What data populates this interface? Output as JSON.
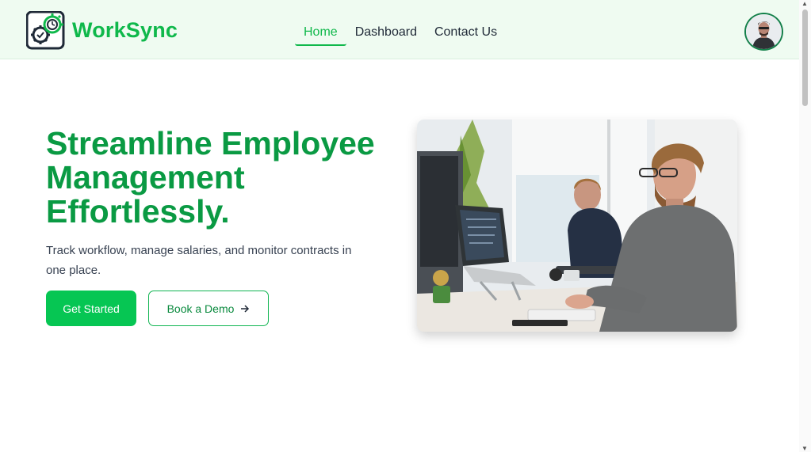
{
  "brand": {
    "name": "WorkSync",
    "icon": "gear-clock-logo-icon",
    "color": "#0fb84b"
  },
  "nav": {
    "items": [
      {
        "label": "Home",
        "active": true
      },
      {
        "label": "Dashboard",
        "active": false
      },
      {
        "label": "Contact Us",
        "active": false
      }
    ]
  },
  "user": {
    "avatar_icon": "user-avatar"
  },
  "hero": {
    "title": "Streamline Employee Management Effortlessly.",
    "subtitle": "Track workflow, manage salaries, and monitor contracts in one place.",
    "primary_button": "Get Started",
    "secondary_button": "Book a Demo",
    "secondary_icon": "arrow-right-icon"
  },
  "colors": {
    "accent": "#06c653",
    "title": "#0a9a43",
    "nav_bg": "#effbf1"
  }
}
